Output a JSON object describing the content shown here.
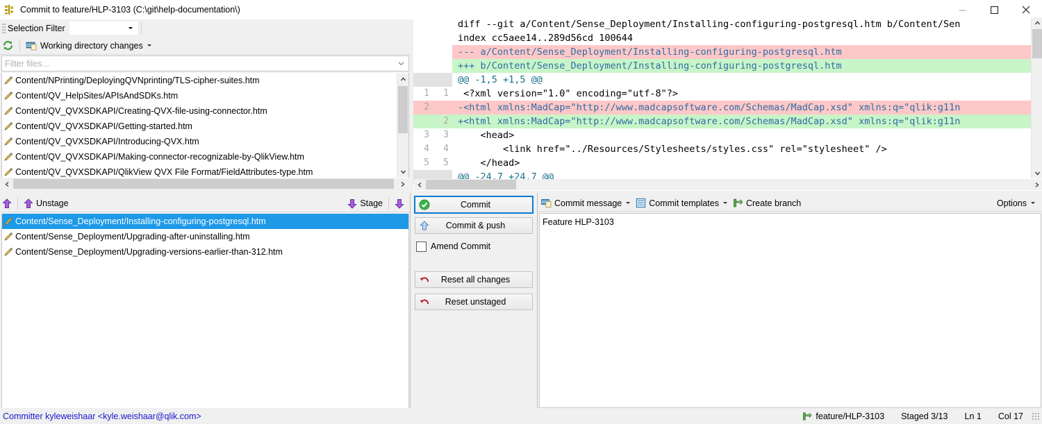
{
  "window": {
    "title": "Commit to feature/HLP-3103 (C:\\git\\help-documentation\\)",
    "icon": "git-extensions-icon",
    "minimize_label": "–",
    "maximize_label": "□",
    "close_label": "✕"
  },
  "selection_toolbar": {
    "label": "Selection Filter",
    "combo_value": "",
    "dropdown_icon": "chevron-down-icon"
  },
  "working_dir_toolbar": {
    "refresh_icon": "refresh-icon",
    "label": "Working directory changes",
    "dropdown_icon": "chevron-down-icon"
  },
  "filter": {
    "placeholder": "Filter files...",
    "value": "",
    "chevron_icon": "chevron-down-icon"
  },
  "unstaged_files": [
    "Content/NPrinting/DeployingQVNprinting/TLS-cipher-suites.htm",
    "Content/QV_HelpSites/APIsAndSDKs.htm",
    "Content/QV_QVXSDKAPI/Creating-QVX-file-using-connector.htm",
    "Content/QV_QVXSDKAPI/Getting-started.htm",
    "Content/QV_QVXSDKAPI/Introducing-QVX.htm",
    "Content/QV_QVXSDKAPI/Making-connector-recognizable-by-QlikView.htm",
    "Content/QV_QVXSDKAPI/QlikView QVX File Format/FieldAttributes-type.htm"
  ],
  "stage_toolbar": {
    "unstage_label": "Unstage",
    "unstage_icon": "arrow-up-icon",
    "unstage_all_icon": "arrow-up-icon",
    "stage_label": "Stage",
    "stage_icon": "arrow-down-icon",
    "stage_all_icon": "arrow-down-icon"
  },
  "staged_files": [
    {
      "path": "Content/Sense_Deployment/Installing-configuring-postgresql.htm",
      "selected": true
    },
    {
      "path": "Content/Sense_Deployment/Upgrading-after-uninstalling.htm",
      "selected": false
    },
    {
      "path": "Content/Sense_Deployment/Upgrading-versions-earlier-than-312.htm",
      "selected": false
    }
  ],
  "commit_panel": {
    "commit_label": "Commit",
    "commit_icon": "green-check-circle-icon",
    "commit_push_label": "Commit & push",
    "commit_push_icon": "arrow-up-icon",
    "amend_label": "Amend Commit",
    "amend_checked": false,
    "reset_all_label": "Reset all changes",
    "reset_all_icon": "undo-icon",
    "reset_unstaged_label": "Reset unstaged",
    "reset_unstaged_icon": "undo-icon"
  },
  "message_toolbar": {
    "commit_message_label": "Commit message",
    "commit_message_icon": "message-icon",
    "commit_templates_label": "Commit templates",
    "commit_templates_icon": "template-icon",
    "create_branch_label": "Create branch",
    "create_branch_icon": "branch-icon",
    "options_label": "Options",
    "dropdown_icon": "chevron-down-icon"
  },
  "commit_message": {
    "value": "Feature HLP-3103"
  },
  "diff": {
    "lines": [
      {
        "kind": "hdr",
        "old": "",
        "new": "",
        "text": "diff --git a/Content/Sense_Deployment/Installing-configuring-postgresql.htm b/Content/Sen"
      },
      {
        "kind": "hdr",
        "old": "",
        "new": "",
        "text": "index cc5aee14..289d56cd 100644"
      },
      {
        "kind": "file-a",
        "old": "",
        "new": "",
        "text": "--- a/Content/Sense_Deployment/Installing-configuring-postgresql.htm"
      },
      {
        "kind": "file-b",
        "old": "",
        "new": "",
        "text": "+++ b/Content/Sense_Deployment/Installing-configuring-postgresql.htm"
      },
      {
        "kind": "hunk",
        "old": "",
        "new": "",
        "text": "@@ -1,5 +1,5 @@"
      },
      {
        "kind": "ctx",
        "old": "1",
        "new": "1",
        "text": " <?xml version=\"1.0\" encoding=\"utf-8\"?>"
      },
      {
        "kind": "minus",
        "old": "2",
        "new": "",
        "text": "-<html xmlns:MadCap=\"http://www.madcapsoftware.com/Schemas/MadCap.xsd\" xmlns:q=\"qlik:g11n"
      },
      {
        "kind": "plus",
        "old": "",
        "new": "2",
        "text": "+<html xmlns:MadCap=\"http://www.madcapsoftware.com/Schemas/MadCap.xsd\" xmlns:q=\"qlik:g11n"
      },
      {
        "kind": "ctx",
        "old": "3",
        "new": "3",
        "text": "    <head>"
      },
      {
        "kind": "ctx",
        "old": "4",
        "new": "4",
        "text": "        <link href=\"../Resources/Stylesheets/styles.css\" rel=\"stylesheet\" />"
      },
      {
        "kind": "ctx",
        "old": "5",
        "new": "5",
        "text": "    </head>"
      },
      {
        "kind": "hunk",
        "old": "",
        "new": "",
        "text": "@@ -24,7 +24,7 @@"
      }
    ]
  },
  "statusbar": {
    "committer": "Committer kyleweishaar <kyle.weishaar@qlik.com>",
    "branch_icon": "branch-icon",
    "branch": "feature/HLP-3103",
    "staged": "Staged  3/13",
    "line": "Ln  1",
    "col": "Col  17"
  },
  "colors": {
    "accent_blue": "#1d99e8",
    "diff_remove_bg": "#ffc8c8",
    "diff_add_bg": "#c8f5c8",
    "diff_text_blue": "#2e6da4",
    "hunk_text": "#16708c",
    "committer_link": "#1818cf",
    "primary_border": "#0a7bd4",
    "chrome_bg": "#f0f0f0"
  }
}
